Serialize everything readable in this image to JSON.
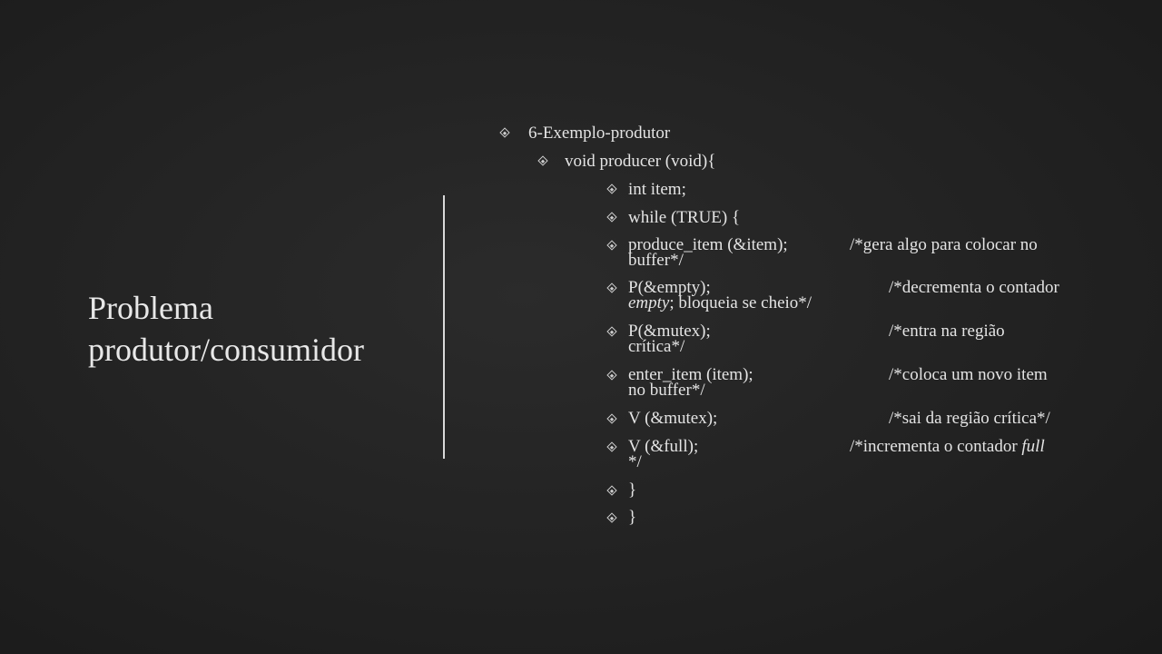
{
  "title": {
    "line1": "Problema",
    "line2": "produtor/consumidor"
  },
  "bullets": {
    "l1": "6-Exemplo-produtor",
    "l2": "void producer (void){",
    "int_item": "int item;",
    "while_true": "while (TRUE) {",
    "produce_item": {
      "code": "produce_item (&item);",
      "comment": "/*gera algo para colocar no",
      "cont": "buffer*/"
    },
    "p_empty": {
      "code": "P(&empty);",
      "comment": "/*decrementa o contador",
      "cont_italic": "empty",
      "cont_rest": "; bloqueia se cheio*/"
    },
    "p_mutex": {
      "code": "P(&mutex);",
      "comment": "/*entra na região",
      "cont": "crítica*/"
    },
    "enter_item": {
      "code": "enter_item (item);",
      "comment": "/*coloca um novo item",
      "cont": "no buffer*/"
    },
    "v_mutex": {
      "code": "V (&mutex);",
      "comment": "/*sai da região crítica*/"
    },
    "v_full": {
      "code": "V (&full);",
      "comment_prefix": "/*incrementa o contador ",
      "comment_italic": "full",
      "cont": "*/"
    },
    "close1": "}",
    "close2": "}"
  },
  "icons": {
    "bullet": "diamond-bullet-icon"
  }
}
